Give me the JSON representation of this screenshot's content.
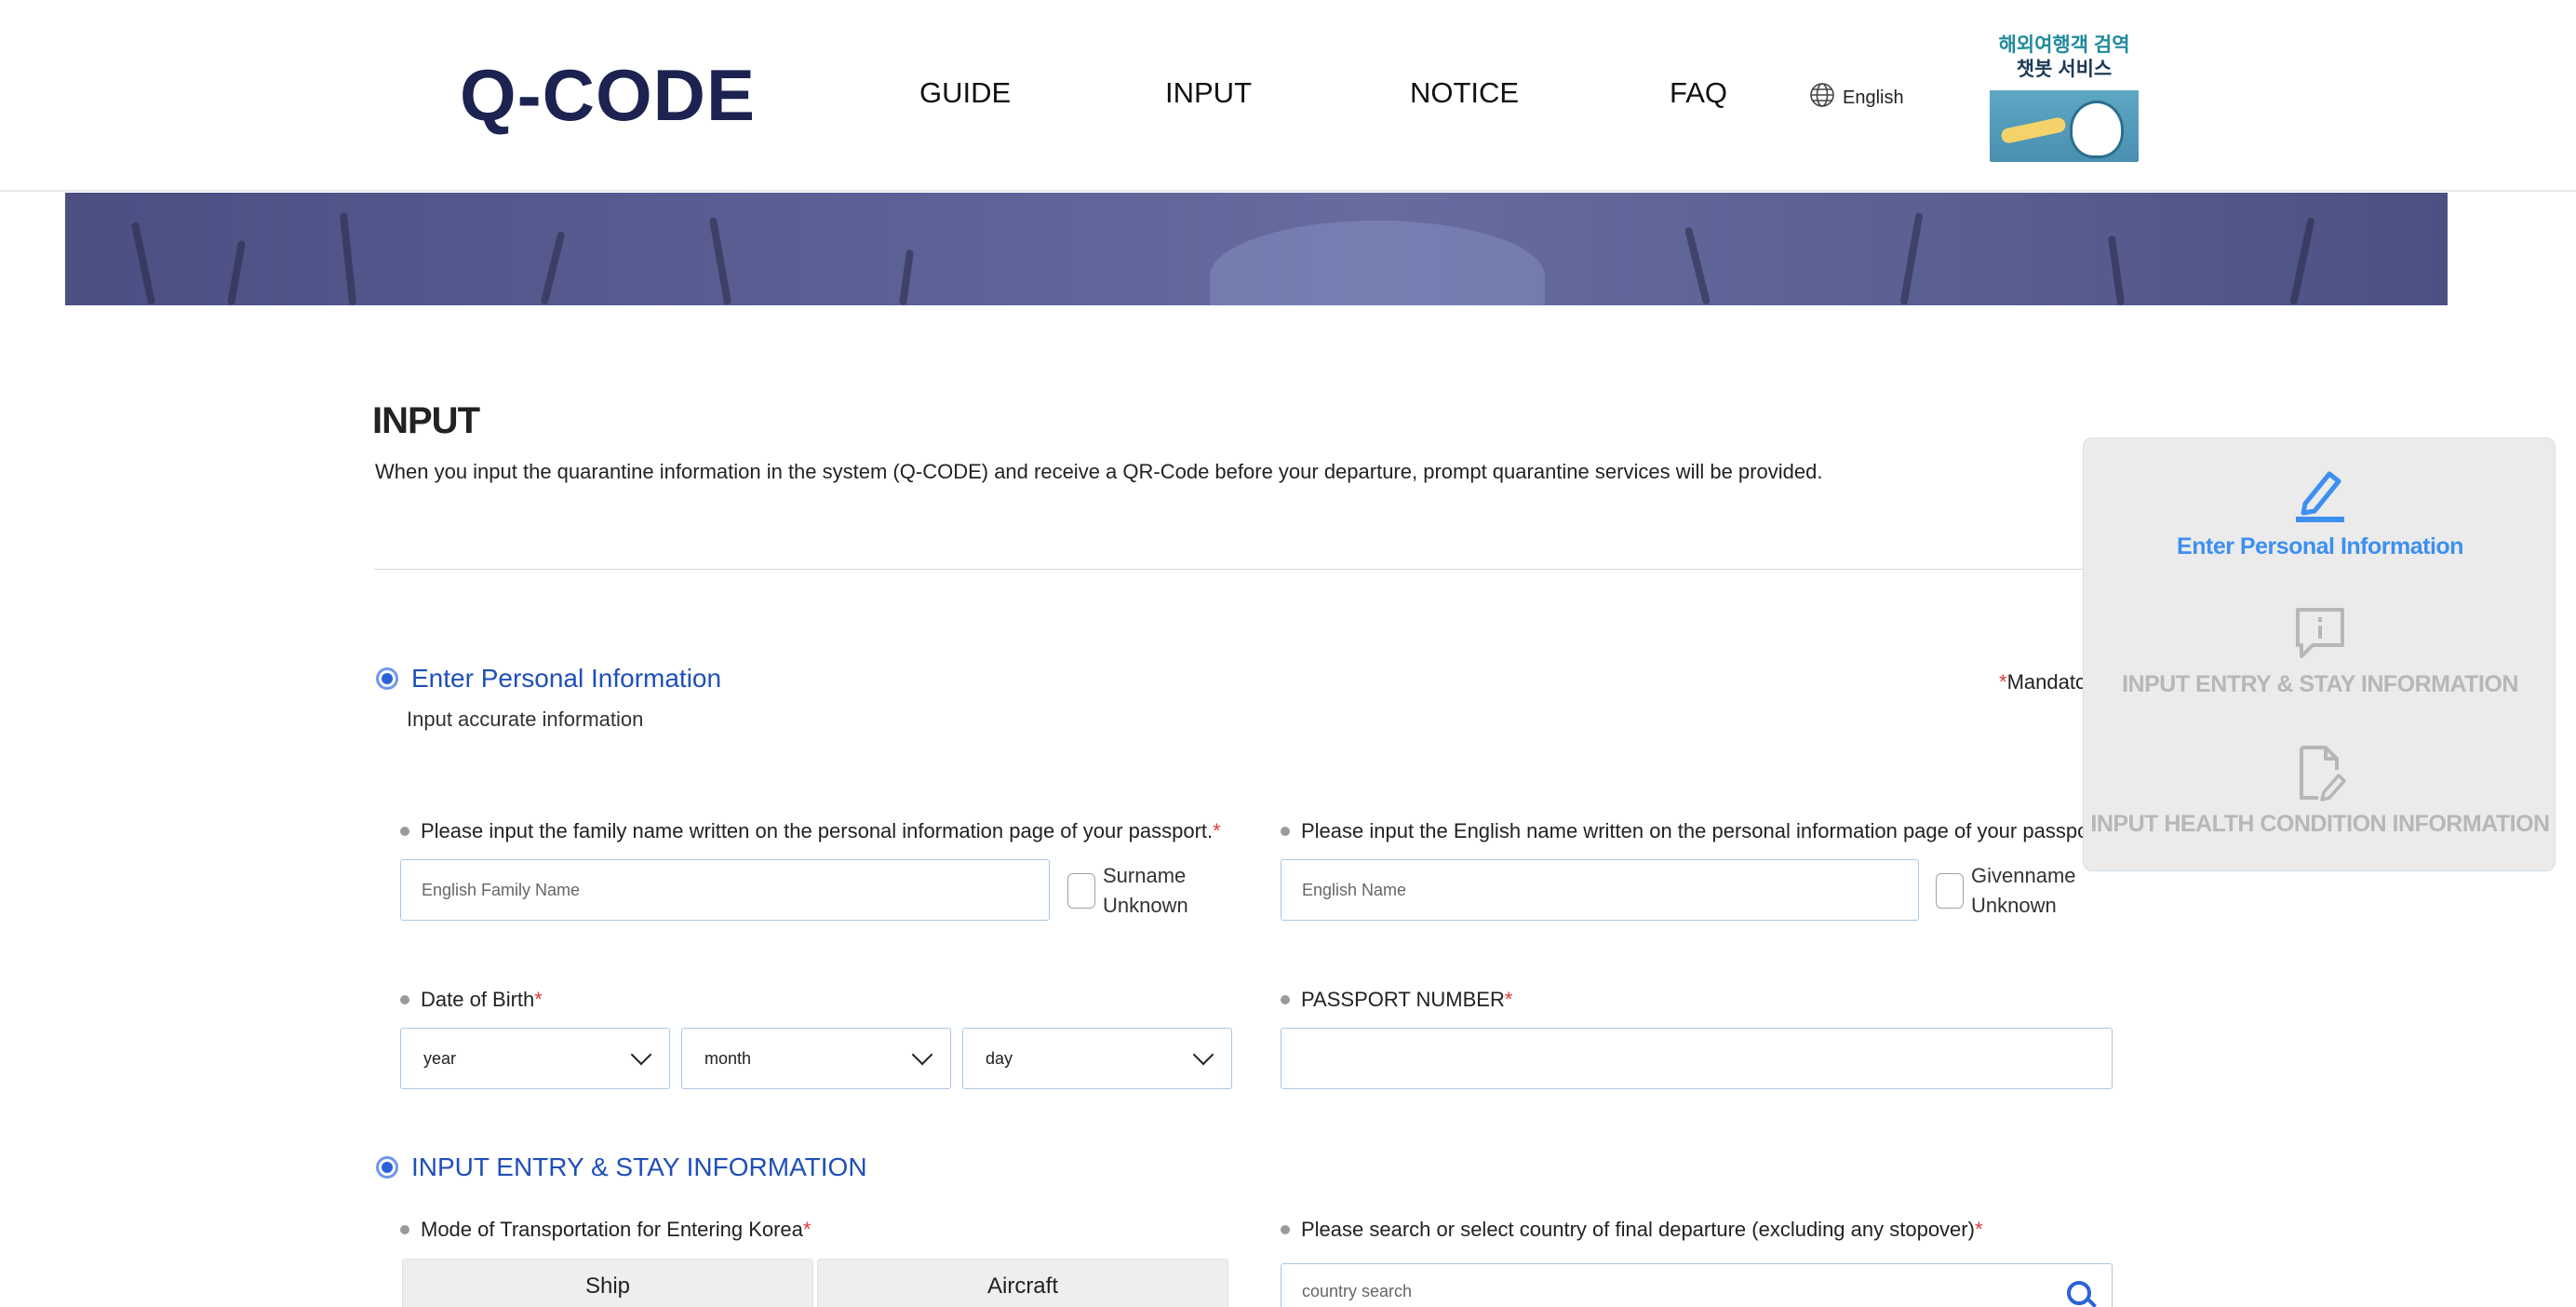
{
  "header": {
    "logo_text": "Q-CODE",
    "nav": [
      "GUIDE",
      "INPUT",
      "NOTICE",
      "FAQ"
    ],
    "language": "English",
    "banner": {
      "line1": "해외여행객 검역",
      "line2": "챗봇 서비스"
    }
  },
  "page": {
    "title": "INPUT",
    "description": "When you input the quarantine information in the system (Q-CODE) and receive a QR-Code before your departure, prompt quarantine services will be provided."
  },
  "personal": {
    "section_title": "Enter Personal Information",
    "section_sub": "Input accurate information",
    "mandatory_label": "Mandato",
    "family_name_label": "Please input the family name written on the personal information page of your passport.",
    "family_name_placeholder": "English Family Name",
    "surname_unknown": "Surname Unknown",
    "given_name_label": "Please input the English name written on the personal information page of your passport.",
    "given_name_placeholder": "English Name",
    "givenname_unknown": "Givenname Unknown",
    "dob_label": "Date of Birth",
    "dob_year": "year",
    "dob_month": "month",
    "dob_day": "day",
    "passport_label": "PASSPORT NUMBER",
    "passport_value": ""
  },
  "entry": {
    "section_title": "INPUT ENTRY & STAY INFORMATION",
    "transport_label": "Mode of Transportation for Entering Korea",
    "transport_options": [
      "Ship",
      "Aircraft"
    ],
    "country_label": "Please search or select country of final departure (excluding any stopover)",
    "country_placeholder": "country search"
  },
  "steps": [
    {
      "label": "Enter Personal Information",
      "icon": "pencil-icon",
      "state": "active"
    },
    {
      "label": "INPUT ENTRY & STAY INFORMATION",
      "icon": "info-message-icon",
      "state": "inactive"
    },
    {
      "label": "INPUT HEALTH CONDITION INFORMATION",
      "icon": "document-edit-icon",
      "state": "inactive"
    }
  ],
  "colors": {
    "accent_blue": "#1f4fb8",
    "active_step": "#3d8ff0",
    "inactive_step": "#b7b7b7",
    "required_star": "#e03a3a",
    "logo_navy": "#1c2351"
  }
}
